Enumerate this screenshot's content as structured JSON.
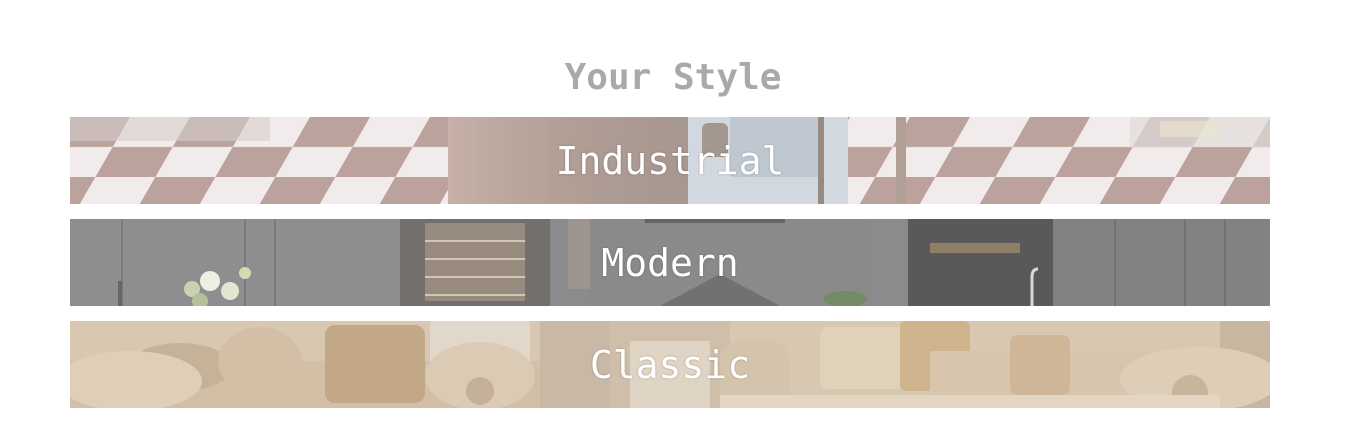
{
  "section": {
    "title": "Your Style"
  },
  "styles": [
    {
      "label": "Industrial",
      "image": "checkered-floor-kitchen"
    },
    {
      "label": "Modern",
      "image": "grey-modern-kitchen"
    },
    {
      "label": "Classic",
      "image": "classic-sofa-living-room"
    }
  ]
}
